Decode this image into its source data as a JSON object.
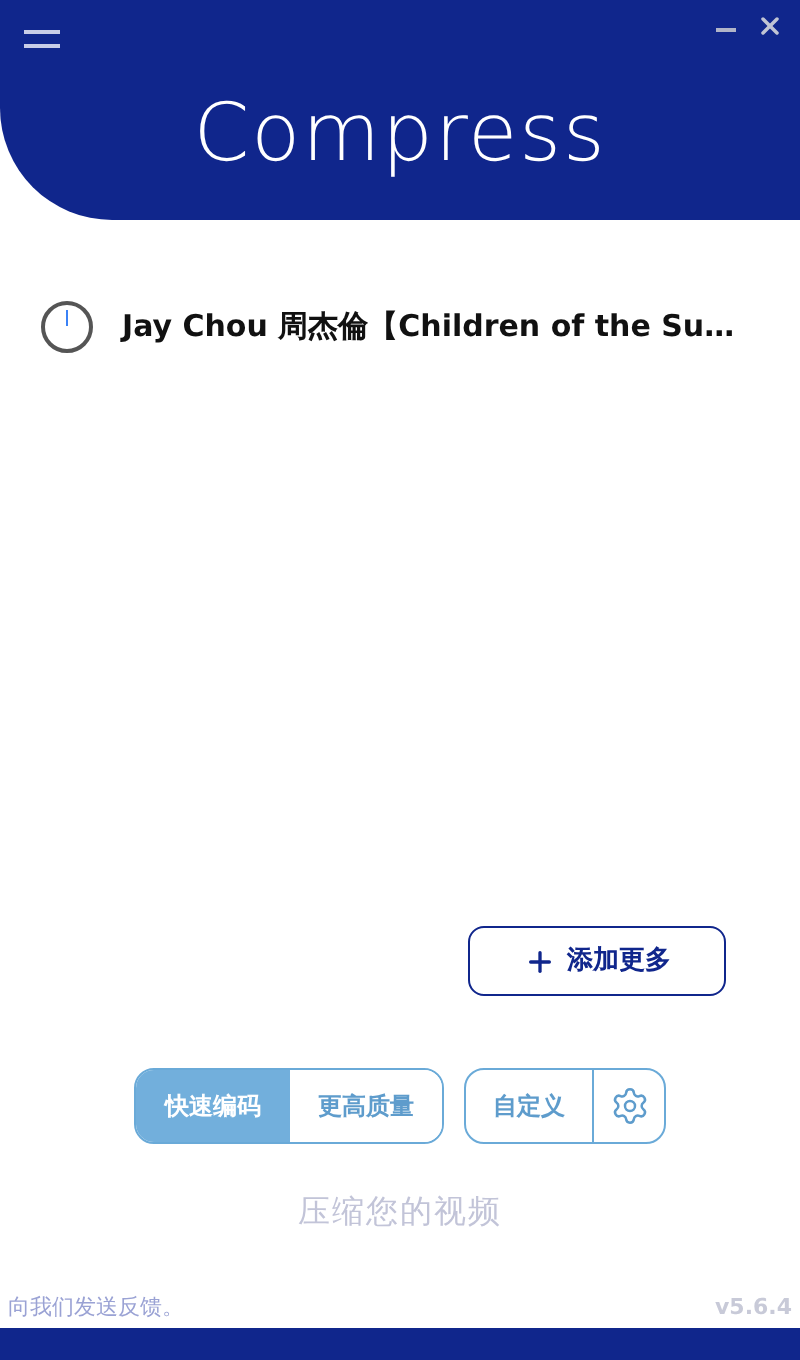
{
  "header": {
    "logo": "Compress"
  },
  "files": [
    {
      "name": "Jay Chou 周杰倫【Children of the Su…"
    }
  ],
  "add_button": {
    "label": "添加更多"
  },
  "modes": [
    {
      "label": "快速编码",
      "selected": true
    },
    {
      "label": "更高质量",
      "selected": false
    }
  ],
  "custom_button": {
    "label": "自定义"
  },
  "action_hint": "压缩您的视频",
  "footer": {
    "feedback": "向我们发送反馈。",
    "version": "v5.6.4"
  }
}
